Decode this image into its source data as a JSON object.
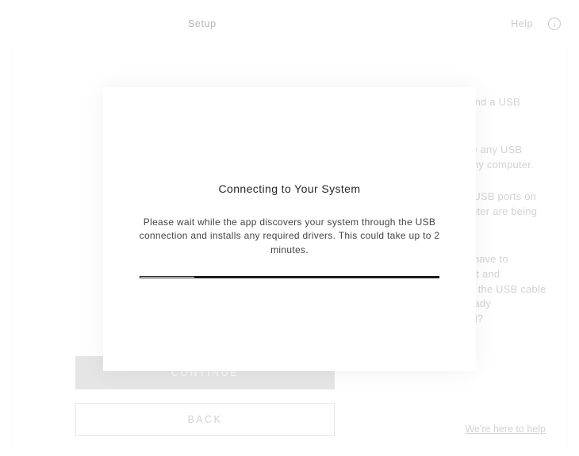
{
  "topbar": {
    "setup_label": "Setup",
    "help_label": "Help",
    "info_icon_name": "info-icon"
  },
  "modal": {
    "title": "Connecting to Your System",
    "body": "Please wait while the app discovers your system through the USB connection and installs any required drivers. This could take up to 2 minutes.",
    "progress_percent": 18
  },
  "buttons": {
    "continue_label": "CONTINUE",
    "back_label": "BACK"
  },
  "faq": {
    "items": [
      "I cannot find a USB cable.",
      "I don't see any USB ports on my computer.",
      "All of the USB ports on my computer are being used.",
      "Why do I have to disconnect and reconnect the USB cable if it is already connected?"
    ]
  },
  "footer": {
    "help_link": "We're here to help"
  }
}
